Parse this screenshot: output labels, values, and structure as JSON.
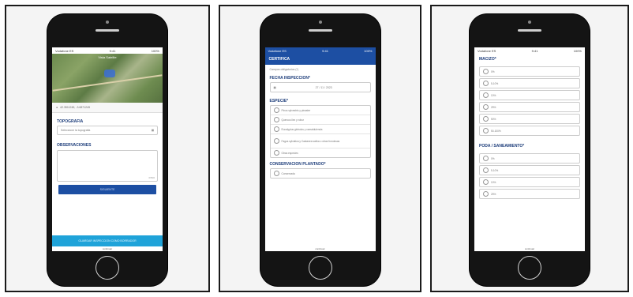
{
  "screen1": {
    "status": {
      "left": "Vodafone ES",
      "time": "9:41",
      "right": "100%"
    },
    "map_label": "Vista Satelite",
    "coordinates": "42.3511245, -3.6871245",
    "topografia": {
      "title": "TOPOGRAFIA",
      "select_placeholder": "Seleccione la topografia"
    },
    "observaciones": {
      "title": "OBSERVACIONES",
      "counter": "0/500"
    },
    "primary_button": "SIGUIENTE",
    "footer_button": "GUARDAR INSPECCION COMO BORRADOR",
    "bottom_label": "continuar"
  },
  "screen2": {
    "status": {
      "left": "Vodafone ES",
      "time": "9:41",
      "right": "100%"
    },
    "app_title": "CERTIFICA",
    "hint": "Campos obligatorios (*)",
    "fecha": {
      "title": "FECHA INSPECCION*",
      "value": "27 / 11 / 2023"
    },
    "especie": {
      "title": "ESPECIE*",
      "options": [
        "Pinus sylvestris y pinaster",
        "Quercus ilex y robur",
        "Eucalyptus globulus y camaldulensis",
        "Fagus sylvatica y Castanea sativa u otras frondosas",
        "Otras especies"
      ]
    },
    "conservacion": {
      "title": "CONSERVACION PLANTADO*",
      "options": [
        "Conservada"
      ]
    },
    "bottom_label": "continuar"
  },
  "screen3": {
    "status": {
      "left": "Vodafone ES",
      "time": "9:41",
      "right": "100%"
    },
    "macizo": {
      "title": "MACIZO*",
      "options": [
        "0%",
        "5-10%",
        "10%",
        "25%",
        "50%",
        "50-100%"
      ]
    },
    "poda": {
      "title": "PODA / SANEAMIENTO*",
      "options": [
        "0%",
        "5-10%",
        "10%",
        "25%"
      ]
    },
    "bottom_label": "continuar"
  },
  "colors": {
    "primary": "#1d4fa3",
    "accent": "#1fa3d9",
    "title_text": "#1d3d7a"
  }
}
